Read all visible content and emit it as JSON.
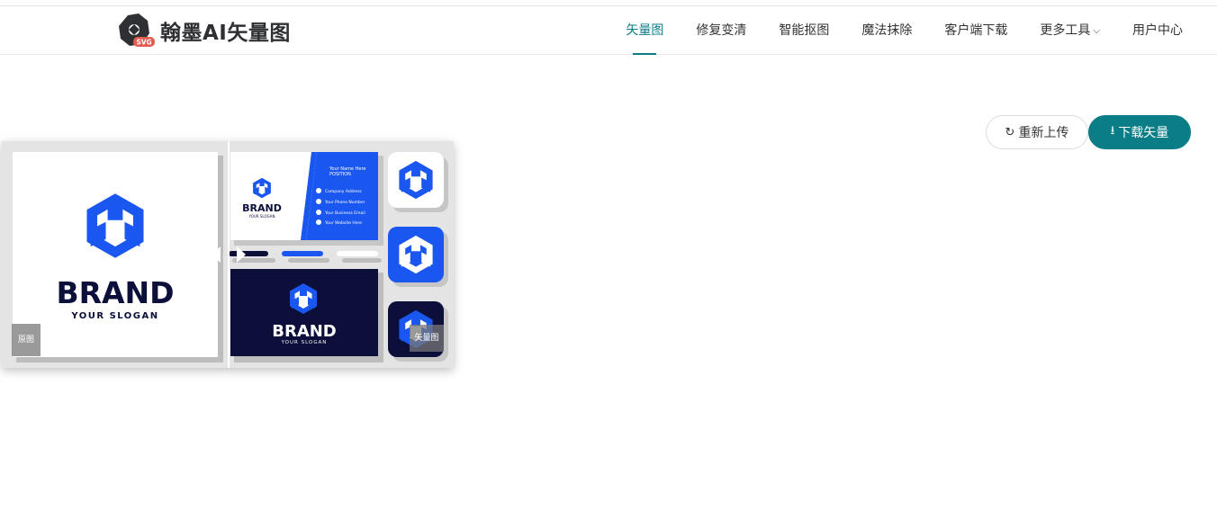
{
  "header": {
    "brand_text": "翰墨AI矢量图",
    "logo_badge": "SVG",
    "nav": [
      {
        "label": "矢量图",
        "active": true
      },
      {
        "label": "修复变清",
        "active": false
      },
      {
        "label": "智能抠图",
        "active": false
      },
      {
        "label": "魔法抹除",
        "active": false
      },
      {
        "label": "客户端下载",
        "active": false
      },
      {
        "label": "更多工具",
        "active": false,
        "has_dropdown": true
      },
      {
        "label": "用户中心",
        "active": false
      }
    ],
    "accent_color": "#0a7d86"
  },
  "actions": {
    "reupload_label": "重新上传",
    "reupload_icon": "refresh-icon",
    "download_label": "下载矢量",
    "download_icon": "download-icon"
  },
  "compare": {
    "original_tag": "原图",
    "vector_tag": "矢量图",
    "left_card": {
      "brand": "BRAND",
      "slogan": "YOUR SLOGAN"
    },
    "business_card": {
      "brand": "BRAND",
      "slogan": "YOUR SLOGAN",
      "name": "Your Name Here",
      "position": "POSITION",
      "lines": [
        "Company Address",
        "Your Phone Number",
        "Your Business Email",
        "Your Website Here"
      ]
    },
    "dark_card": {
      "brand": "BRAND",
      "slogan": "YOUR SLOGAN"
    },
    "brand_blue": "#1a56f0",
    "navy": "#0b0f3a"
  }
}
